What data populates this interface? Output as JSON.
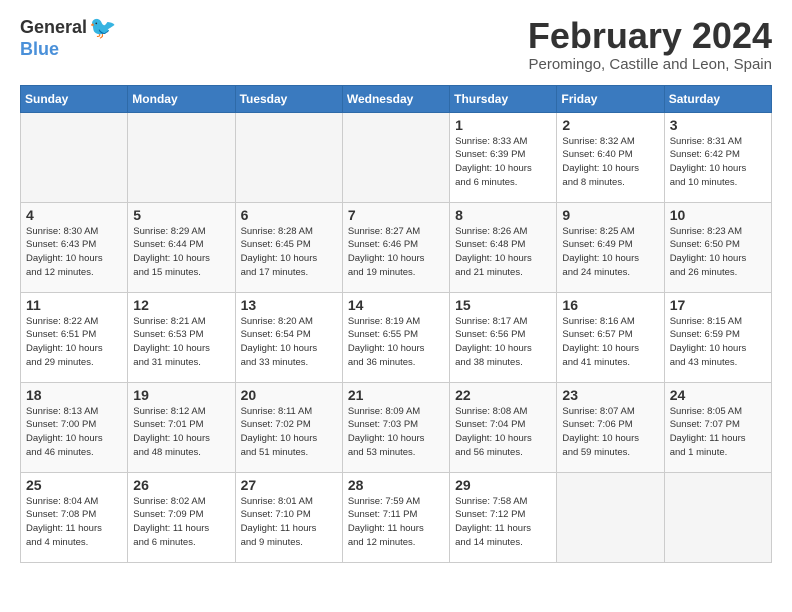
{
  "app": {
    "name_general": "General",
    "name_blue": "Blue"
  },
  "header": {
    "title": "February 2024",
    "subtitle": "Peromingo, Castille and Leon, Spain"
  },
  "weekdays": [
    "Sunday",
    "Monday",
    "Tuesday",
    "Wednesday",
    "Thursday",
    "Friday",
    "Saturday"
  ],
  "weeks": [
    [
      {
        "day": "",
        "info": ""
      },
      {
        "day": "",
        "info": ""
      },
      {
        "day": "",
        "info": ""
      },
      {
        "day": "",
        "info": ""
      },
      {
        "day": "1",
        "info": "Sunrise: 8:33 AM\nSunset: 6:39 PM\nDaylight: 10 hours\nand 6 minutes."
      },
      {
        "day": "2",
        "info": "Sunrise: 8:32 AM\nSunset: 6:40 PM\nDaylight: 10 hours\nand 8 minutes."
      },
      {
        "day": "3",
        "info": "Sunrise: 8:31 AM\nSunset: 6:42 PM\nDaylight: 10 hours\nand 10 minutes."
      }
    ],
    [
      {
        "day": "4",
        "info": "Sunrise: 8:30 AM\nSunset: 6:43 PM\nDaylight: 10 hours\nand 12 minutes."
      },
      {
        "day": "5",
        "info": "Sunrise: 8:29 AM\nSunset: 6:44 PM\nDaylight: 10 hours\nand 15 minutes."
      },
      {
        "day": "6",
        "info": "Sunrise: 8:28 AM\nSunset: 6:45 PM\nDaylight: 10 hours\nand 17 minutes."
      },
      {
        "day": "7",
        "info": "Sunrise: 8:27 AM\nSunset: 6:46 PM\nDaylight: 10 hours\nand 19 minutes."
      },
      {
        "day": "8",
        "info": "Sunrise: 8:26 AM\nSunset: 6:48 PM\nDaylight: 10 hours\nand 21 minutes."
      },
      {
        "day": "9",
        "info": "Sunrise: 8:25 AM\nSunset: 6:49 PM\nDaylight: 10 hours\nand 24 minutes."
      },
      {
        "day": "10",
        "info": "Sunrise: 8:23 AM\nSunset: 6:50 PM\nDaylight: 10 hours\nand 26 minutes."
      }
    ],
    [
      {
        "day": "11",
        "info": "Sunrise: 8:22 AM\nSunset: 6:51 PM\nDaylight: 10 hours\nand 29 minutes."
      },
      {
        "day": "12",
        "info": "Sunrise: 8:21 AM\nSunset: 6:53 PM\nDaylight: 10 hours\nand 31 minutes."
      },
      {
        "day": "13",
        "info": "Sunrise: 8:20 AM\nSunset: 6:54 PM\nDaylight: 10 hours\nand 33 minutes."
      },
      {
        "day": "14",
        "info": "Sunrise: 8:19 AM\nSunset: 6:55 PM\nDaylight: 10 hours\nand 36 minutes."
      },
      {
        "day": "15",
        "info": "Sunrise: 8:17 AM\nSunset: 6:56 PM\nDaylight: 10 hours\nand 38 minutes."
      },
      {
        "day": "16",
        "info": "Sunrise: 8:16 AM\nSunset: 6:57 PM\nDaylight: 10 hours\nand 41 minutes."
      },
      {
        "day": "17",
        "info": "Sunrise: 8:15 AM\nSunset: 6:59 PM\nDaylight: 10 hours\nand 43 minutes."
      }
    ],
    [
      {
        "day": "18",
        "info": "Sunrise: 8:13 AM\nSunset: 7:00 PM\nDaylight: 10 hours\nand 46 minutes."
      },
      {
        "day": "19",
        "info": "Sunrise: 8:12 AM\nSunset: 7:01 PM\nDaylight: 10 hours\nand 48 minutes."
      },
      {
        "day": "20",
        "info": "Sunrise: 8:11 AM\nSunset: 7:02 PM\nDaylight: 10 hours\nand 51 minutes."
      },
      {
        "day": "21",
        "info": "Sunrise: 8:09 AM\nSunset: 7:03 PM\nDaylight: 10 hours\nand 53 minutes."
      },
      {
        "day": "22",
        "info": "Sunrise: 8:08 AM\nSunset: 7:04 PM\nDaylight: 10 hours\nand 56 minutes."
      },
      {
        "day": "23",
        "info": "Sunrise: 8:07 AM\nSunset: 7:06 PM\nDaylight: 10 hours\nand 59 minutes."
      },
      {
        "day": "24",
        "info": "Sunrise: 8:05 AM\nSunset: 7:07 PM\nDaylight: 11 hours\nand 1 minute."
      }
    ],
    [
      {
        "day": "25",
        "info": "Sunrise: 8:04 AM\nSunset: 7:08 PM\nDaylight: 11 hours\nand 4 minutes."
      },
      {
        "day": "26",
        "info": "Sunrise: 8:02 AM\nSunset: 7:09 PM\nDaylight: 11 hours\nand 6 minutes."
      },
      {
        "day": "27",
        "info": "Sunrise: 8:01 AM\nSunset: 7:10 PM\nDaylight: 11 hours\nand 9 minutes."
      },
      {
        "day": "28",
        "info": "Sunrise: 7:59 AM\nSunset: 7:11 PM\nDaylight: 11 hours\nand 12 minutes."
      },
      {
        "day": "29",
        "info": "Sunrise: 7:58 AM\nSunset: 7:12 PM\nDaylight: 11 hours\nand 14 minutes."
      },
      {
        "day": "",
        "info": ""
      },
      {
        "day": "",
        "info": ""
      }
    ]
  ]
}
